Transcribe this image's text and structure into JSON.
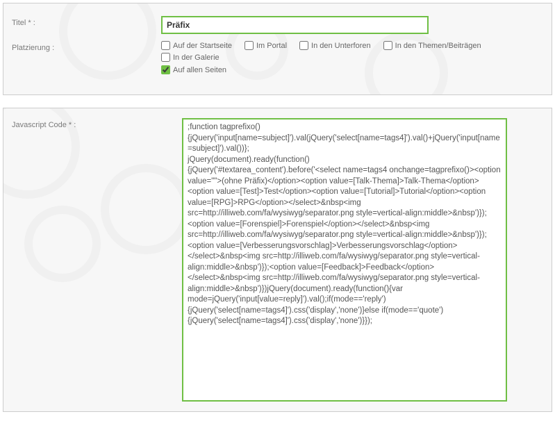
{
  "panel1": {
    "title_label": "Titel * :",
    "title_value": "Präfix",
    "placement_label": "Platzierung :",
    "checkboxes": [
      {
        "label": "Auf der Startseite",
        "checked": false
      },
      {
        "label": "Im Portal",
        "checked": false
      },
      {
        "label": "In den Unterforen",
        "checked": false
      },
      {
        "label": "In den Themen/Beiträgen",
        "checked": false
      },
      {
        "label": "In der Galerie",
        "checked": false
      },
      {
        "label": "Auf allen Seiten",
        "checked": true
      }
    ]
  },
  "panel2": {
    "code_label": "Javascript Code * :",
    "code_value": ";function tagprefixo()\n{jQuery('input[name=subject]').val(jQuery('select[name=tags4]').val()+jQuery('input[name=subject]').val())};\njQuery(document).ready(function()\n{jQuery('#textarea_content').before('<select name=tags4 onchange=tagprefixo()><option value=\"\">(ohne Präfix)</option><option value=[Talk-Thema]>Talk-Thema</option><option value=[Test]>Test</option><option value=[Tutorial]>Tutorial</option><option value=[RPG]>RPG</option></select>&nbsp<img src=http://illiweb.com/fa/wysiwyg/separator.png style=vertical-align:middle>&nbsp')});<option value=[Forenspiel]>Forenspiel</option></select>&nbsp<img src=http://illiweb.com/fa/wysiwyg/separator.png style=vertical-align:middle>&nbsp')});<option value=[Verbesserungsvorschlag]>Verbesserungsvorschlag</option></select>&nbsp<img src=http://illiweb.com/fa/wysiwyg/separator.png style=vertical-align:middle>&nbsp')});<option value=[Feedback]>Feedback</option></select>&nbsp<img src=http://illiweb.com/fa/wysiwyg/separator.png style=vertical-align:middle>&nbsp')})jQuery(document).ready(function(){var mode=jQuery('input[value=reply]').val();if(mode=='reply'){jQuery('select[name=tags4]').css('display','none')}else if(mode=='quote'){jQuery('select[name=tags4]').css('display','none')}});"
  }
}
